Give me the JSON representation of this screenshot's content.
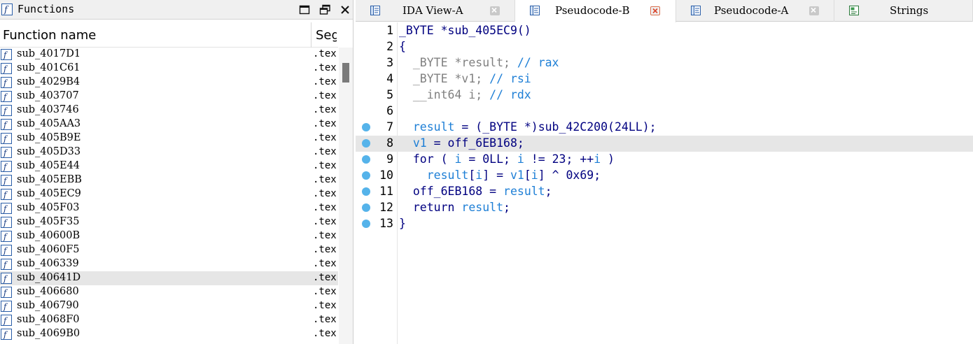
{
  "functions_panel": {
    "title": "Functions",
    "title_icon": "function-f-icon",
    "controls": [
      "maximize-icon",
      "float-window-icon",
      "close-icon"
    ],
    "columns": {
      "name": "Function name",
      "segment": "Seg"
    },
    "rows": [
      {
        "name": "sub_4017D1",
        "segment": ".text"
      },
      {
        "name": "sub_401C61",
        "segment": ".text"
      },
      {
        "name": "sub_4029B4",
        "segment": ".text"
      },
      {
        "name": "sub_403707",
        "segment": ".text"
      },
      {
        "name": "sub_403746",
        "segment": ".text"
      },
      {
        "name": "sub_405AA3",
        "segment": ".text"
      },
      {
        "name": "sub_405B9E",
        "segment": ".text"
      },
      {
        "name": "sub_405D33",
        "segment": ".text"
      },
      {
        "name": "sub_405E44",
        "segment": ".text"
      },
      {
        "name": "sub_405EBB",
        "segment": ".text"
      },
      {
        "name": "sub_405EC9",
        "segment": ".text"
      },
      {
        "name": "sub_405F03",
        "segment": ".text"
      },
      {
        "name": "sub_405F35",
        "segment": ".text"
      },
      {
        "name": "sub_40600B",
        "segment": ".text"
      },
      {
        "name": "sub_4060F5",
        "segment": ".text"
      },
      {
        "name": "sub_406339",
        "segment": ".text"
      },
      {
        "name": "sub_40641D",
        "segment": ".text",
        "selected": true
      },
      {
        "name": "sub_406680",
        "segment": ".text"
      },
      {
        "name": "sub_406790",
        "segment": ".text"
      },
      {
        "name": "sub_4068F0",
        "segment": ".text"
      },
      {
        "name": "sub_4069B0",
        "segment": ".text"
      }
    ]
  },
  "tabs": [
    {
      "label": "IDA View-A",
      "icon": "disassembly-view-icon",
      "close": "gray",
      "active": false
    },
    {
      "label": "Pseudocode-B",
      "icon": "pseudocode-icon",
      "close": "red",
      "active": true
    },
    {
      "label": "Pseudocode-A",
      "icon": "pseudocode-icon",
      "close": "gray",
      "active": false
    },
    {
      "label": "Strings",
      "icon": "strings-icon",
      "close": "none",
      "active": false
    }
  ],
  "code": {
    "lines": [
      {
        "n": "1",
        "bp": false,
        "tokens": [
          [
            "_BYTE *sub_405EC9()",
            "blk"
          ]
        ]
      },
      {
        "n": "2",
        "bp": false,
        "tokens": [
          [
            "{",
            "blk"
          ]
        ]
      },
      {
        "n": "3",
        "bp": false,
        "tokens": [
          [
            "  _BYTE *result; ",
            "gray"
          ],
          [
            "// rax",
            "var"
          ]
        ]
      },
      {
        "n": "4",
        "bp": false,
        "tokens": [
          [
            "  _BYTE *v1; ",
            "gray"
          ],
          [
            "// rsi",
            "var"
          ]
        ]
      },
      {
        "n": "5",
        "bp": false,
        "tokens": [
          [
            "  __int64 i; ",
            "gray"
          ],
          [
            "// rdx",
            "var"
          ]
        ]
      },
      {
        "n": "6",
        "bp": false,
        "tokens": []
      },
      {
        "n": "7",
        "bp": true,
        "tokens": [
          [
            "  ",
            "blk"
          ],
          [
            "result",
            "var"
          ],
          [
            " = (_BYTE *)sub_42C200(24LL);",
            "blk"
          ]
        ]
      },
      {
        "n": "8",
        "bp": true,
        "highlight": true,
        "tokens": [
          [
            "  ",
            "blk"
          ],
          [
            "v1",
            "var"
          ],
          [
            " = off_6EB168;",
            "blk"
          ]
        ]
      },
      {
        "n": "9",
        "bp": true,
        "tokens": [
          [
            "  for ( ",
            "blk"
          ],
          [
            "i",
            "var"
          ],
          [
            " = 0LL; ",
            "blk"
          ],
          [
            "i",
            "var"
          ],
          [
            " != 23; ++",
            "blk"
          ],
          [
            "i",
            "var"
          ],
          [
            " )",
            "blk"
          ]
        ]
      },
      {
        "n": "10",
        "bp": true,
        "tokens": [
          [
            "    ",
            "blk"
          ],
          [
            "result",
            "var"
          ],
          [
            "[",
            "blk"
          ],
          [
            "i",
            "var"
          ],
          [
            "] = ",
            "blk"
          ],
          [
            "v1",
            "var"
          ],
          [
            "[",
            "blk"
          ],
          [
            "i",
            "var"
          ],
          [
            "] ^ 0x69;",
            "blk"
          ]
        ]
      },
      {
        "n": "11",
        "bp": true,
        "tokens": [
          [
            "  off_6EB168 = ",
            "blk"
          ],
          [
            "result",
            "var"
          ],
          [
            ";",
            "blk"
          ]
        ]
      },
      {
        "n": "12",
        "bp": true,
        "tokens": [
          [
            "  return ",
            "blk"
          ],
          [
            "result",
            "var"
          ],
          [
            ";",
            "blk"
          ]
        ]
      },
      {
        "n": "13",
        "bp": true,
        "tokens": [
          [
            "}",
            "blk"
          ]
        ]
      }
    ]
  },
  "colors": {
    "keyword_text": "#000080",
    "comment_text": "#808080",
    "variable_text": "#1e7fd6",
    "breakpoint_dot": "#55b3ea",
    "selection": "#e6e6e6"
  }
}
